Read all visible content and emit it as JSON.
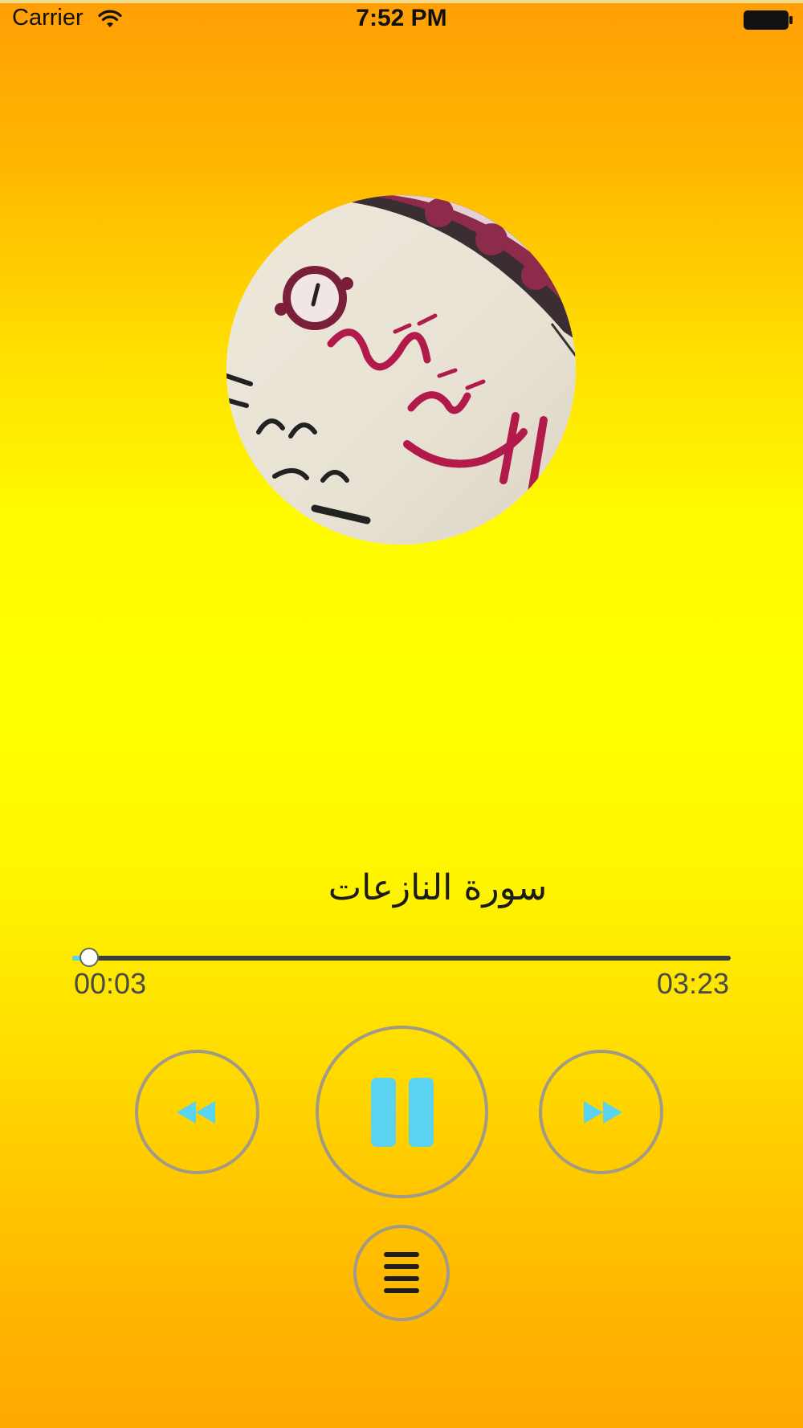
{
  "status_bar": {
    "carrier": "Carrier",
    "time": "7:52 PM"
  },
  "player": {
    "track_title": "سورة النازعات",
    "elapsed": "00:03",
    "duration": "03:23",
    "progress_fraction": 0.025,
    "state": "playing"
  },
  "colors": {
    "accent": "#5AD2F0",
    "button_ring": "#A19A86",
    "background_top": "#FF9E05",
    "background_mid": "#FFFF00",
    "background_bottom": "#FFA800"
  },
  "icons": {
    "rewind": "rewind-icon",
    "pause": "pause-icon",
    "forward": "fast-forward-icon",
    "playlist": "list-icon"
  }
}
